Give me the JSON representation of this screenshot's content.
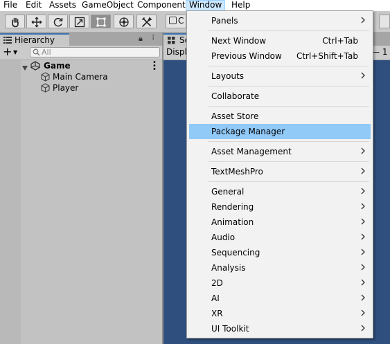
{
  "menubar": {
    "items": [
      {
        "label": "File"
      },
      {
        "label": "Edit"
      },
      {
        "label": "Assets"
      },
      {
        "label": "GameObject"
      },
      {
        "label": "Component"
      },
      {
        "label": "Window",
        "active": true
      },
      {
        "label": "Help"
      }
    ]
  },
  "toolbar": {
    "tools": [
      "hand-tool-icon",
      "move-tool-icon",
      "rotate-tool-icon",
      "scale-tool-icon",
      "rect-tool-icon",
      "transform-tool-icon",
      "custom-tool-icon"
    ],
    "selected_tool": "rect-tool-icon",
    "partial_label": "C"
  },
  "hierarchy": {
    "tab_label": "Hierarchy",
    "search_placeholder": "All",
    "scene": {
      "name": "Game",
      "children": [
        "Main Camera",
        "Player"
      ]
    }
  },
  "scene_panel": {
    "tab_label": "Sc",
    "display_label": "Displ",
    "scale_readout": "1"
  },
  "window_menu": {
    "items": [
      {
        "label": "Panels",
        "submenu": true
      },
      {
        "separator": true
      },
      {
        "label": "Next Window",
        "shortcut": "Ctrl+Tab"
      },
      {
        "label": "Previous Window",
        "shortcut": "Ctrl+Shift+Tab"
      },
      {
        "separator": true
      },
      {
        "label": "Layouts",
        "submenu": true
      },
      {
        "separator": true
      },
      {
        "label": "Collaborate"
      },
      {
        "separator": true
      },
      {
        "label": "Asset Store"
      },
      {
        "label": "Package Manager",
        "highlighted": true
      },
      {
        "separator": true
      },
      {
        "label": "Asset Management",
        "submenu": true
      },
      {
        "separator": true
      },
      {
        "label": "TextMeshPro",
        "submenu": true
      },
      {
        "separator": true
      },
      {
        "label": "General",
        "submenu": true
      },
      {
        "label": "Rendering",
        "submenu": true
      },
      {
        "label": "Animation",
        "submenu": true
      },
      {
        "label": "Audio",
        "submenu": true
      },
      {
        "label": "Sequencing",
        "submenu": true
      },
      {
        "label": "Analysis",
        "submenu": true
      },
      {
        "label": "2D",
        "submenu": true
      },
      {
        "label": "AI",
        "submenu": true
      },
      {
        "label": "XR",
        "submenu": true
      },
      {
        "label": "UI Toolkit",
        "submenu": true
      }
    ]
  },
  "colors": {
    "scene_background": "#2f4f7e",
    "menu_highlight": "#91c9f7",
    "menubar_active": "#cce8ff"
  }
}
